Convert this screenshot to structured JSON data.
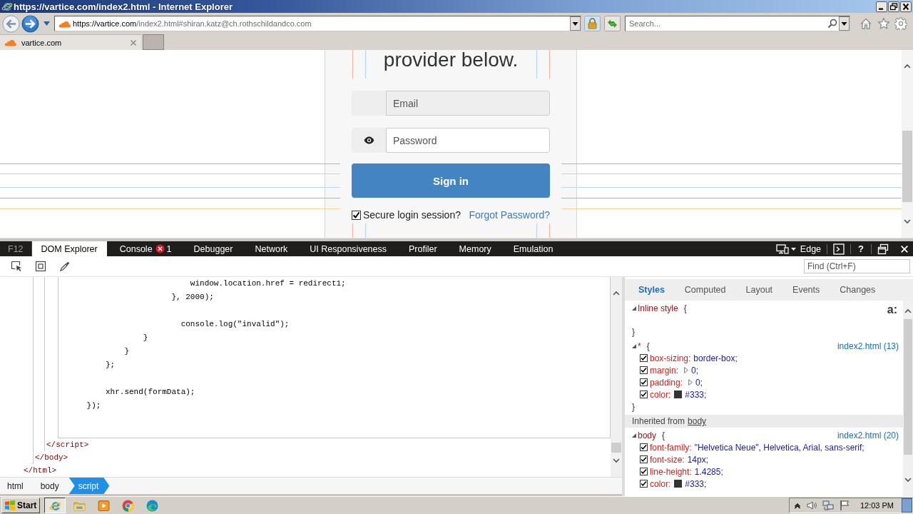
{
  "window": {
    "title": "https://vartice.com/index2.html - Internet Explorer"
  },
  "address_bar": {
    "host": "https://vartice.com",
    "path": "/index2.html#shiran.katz@ch.rothschildandco.com"
  },
  "search": {
    "placeholder": "Search..."
  },
  "tabs": [
    {
      "label": "vartice.com",
      "selected": true
    }
  ],
  "page": {
    "heading": "provider below.",
    "email": {
      "placeholder": "Email"
    },
    "password": {
      "placeholder": "Password"
    },
    "sign_in": "Sign in",
    "secure_session": {
      "label": "Secure login session?",
      "checked": true
    },
    "forgot_password": "Forgot Password?"
  },
  "devtools": {
    "label": "F12",
    "tabs": [
      {
        "label": "DOM Explorer",
        "selected": true
      },
      {
        "label": "Console",
        "selected": false,
        "badge": "1"
      },
      {
        "label": "Debugger",
        "selected": false
      },
      {
        "label": "Network",
        "selected": false
      },
      {
        "label": "UI Responsiveness",
        "selected": false
      },
      {
        "label": "Profiler",
        "selected": false
      },
      {
        "label": "Memory",
        "selected": false
      },
      {
        "label": "Emulation",
        "selected": false
      }
    ],
    "emulation_mode": "Edge",
    "help": "?",
    "find": {
      "placeholder": "Find (Ctrl+F)"
    },
    "code_blocks": [
      [
        "                            window.location.href = redirect1;",
        "                        }, 2000);"
      ],
      [
        "                          console.log(\"invalid\");",
        "                  }",
        "              }",
        "          };"
      ],
      [
        "          xhr.send(formData);",
        "      });"
      ]
    ],
    "closing_tags": [
      "</script>",
      "</body>",
      "</html>"
    ],
    "breadcrumb": [
      {
        "label": "html",
        "selected": false
      },
      {
        "label": "body",
        "selected": false
      },
      {
        "label": "script",
        "selected": true
      }
    ],
    "styles": {
      "tabs": [
        {
          "label": "Styles",
          "selected": true
        },
        {
          "label": "Computed",
          "selected": false
        },
        {
          "label": "Layout",
          "selected": false
        },
        {
          "label": "Events",
          "selected": false
        },
        {
          "label": "Changes",
          "selected": false
        }
      ],
      "pseudo_toggle": "a:",
      "sections": [
        {
          "kind": "rule",
          "expanded": true,
          "selector": "Inline style",
          "open": "{",
          "close": "}"
        },
        {
          "kind": "rule",
          "expanded": true,
          "selector": "*",
          "open": "{",
          "source": "index2.html (13)",
          "declarations": [
            {
              "kind": "plain",
              "property": "box-sizing:",
              "value": "border-box;",
              "enabled": true
            },
            {
              "kind": "shorthand",
              "property": "margin:",
              "value": "0;",
              "enabled": true
            },
            {
              "kind": "shorthand",
              "property": "padding:",
              "value": "0;",
              "enabled": true
            },
            {
              "kind": "color",
              "property": "color:",
              "value": "#333;",
              "color": "#333333",
              "enabled": true
            }
          ],
          "close": "}"
        },
        {
          "kind": "inherited",
          "label": "Inherited from",
          "link": "body"
        },
        {
          "kind": "rule",
          "expanded": true,
          "selector": "body",
          "open": "{",
          "source": "index2.html (20)",
          "declarations": [
            {
              "kind": "plain",
              "property": "font-family:",
              "value": "\"Helvetica Neue\", Helvetica, Arial, sans-serif;",
              "enabled": true
            },
            {
              "kind": "plain",
              "property": "font-size:",
              "value": "14px;",
              "enabled": true
            },
            {
              "kind": "plain",
              "property": "line-height:",
              "value": "1.4285;",
              "enabled": true
            },
            {
              "kind": "color",
              "property": "color:",
              "value": "#333;",
              "color": "#333333",
              "enabled": true
            }
          ]
        }
      ]
    }
  },
  "taskbar": {
    "start": "Start",
    "apps": [
      {
        "kind": "ie",
        "selected": true
      },
      {
        "kind": "folder",
        "selected": false
      },
      {
        "kind": "media",
        "selected": false
      },
      {
        "kind": "chrome",
        "selected": false
      },
      {
        "kind": "edge",
        "selected": false
      }
    ],
    "clock": "12:03 PM"
  }
}
